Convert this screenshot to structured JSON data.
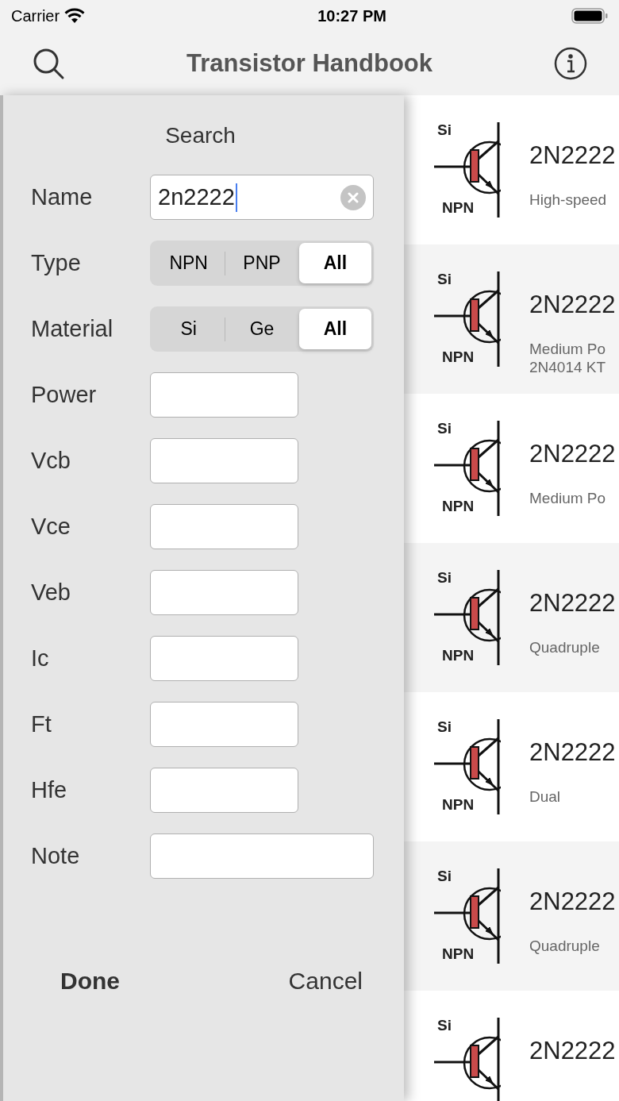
{
  "status_bar": {
    "carrier": "Carrier",
    "time": "10:27 PM"
  },
  "nav_bar": {
    "title": "Transistor Handbook"
  },
  "search_panel": {
    "title": "Search",
    "fields": [
      {
        "kind": "text",
        "label": "Name",
        "value": "2n2222",
        "focused": true,
        "wide": true
      },
      {
        "kind": "segmented",
        "label": "Type",
        "options": [
          {
            "label": "NPN",
            "selected": false
          },
          {
            "label": "PNP",
            "selected": false
          },
          {
            "label": "All",
            "selected": true
          }
        ]
      },
      {
        "kind": "segmented",
        "label": "Material",
        "options": [
          {
            "label": "Si",
            "selected": false
          },
          {
            "label": "Ge",
            "selected": false
          },
          {
            "label": "All",
            "selected": true
          }
        ]
      },
      {
        "kind": "text",
        "label": "Power",
        "wide": false
      },
      {
        "kind": "text",
        "label": "Vcb",
        "wide": false
      },
      {
        "kind": "text",
        "label": "Vce",
        "wide": false
      },
      {
        "kind": "text",
        "label": "Veb",
        "wide": false
      },
      {
        "kind": "text",
        "label": "Ic",
        "wide": false
      },
      {
        "kind": "text",
        "label": "Ft",
        "wide": false
      },
      {
        "kind": "text",
        "label": "Hfe",
        "wide": false
      },
      {
        "kind": "text",
        "label": "Note",
        "wide": true
      }
    ],
    "buttons": [
      {
        "label": "Done",
        "bold": true
      },
      {
        "label": "Cancel",
        "bold": false
      }
    ]
  },
  "results": [
    {
      "material": "Si",
      "type": "NPN",
      "name": "2N2222",
      "description": [
        "High-speed"
      ]
    },
    {
      "material": "Si",
      "type": "NPN",
      "name": "2N2222",
      "description": [
        "Medium Po",
        "2N4014 KT"
      ]
    },
    {
      "material": "Si",
      "type": "NPN",
      "name": "2N2222",
      "description": [
        "Medium Po"
      ]
    },
    {
      "material": "Si",
      "type": "NPN",
      "name": "2N2222",
      "description": [
        "Quadruple"
      ]
    },
    {
      "material": "Si",
      "type": "NPN",
      "name": "2N2222",
      "description": [
        "Dual"
      ]
    },
    {
      "material": "Si",
      "type": "NPN",
      "name": "2N2222",
      "description": [
        "Quadruple"
      ]
    },
    {
      "material": "Si",
      "name": "2N2222"
    }
  ]
}
